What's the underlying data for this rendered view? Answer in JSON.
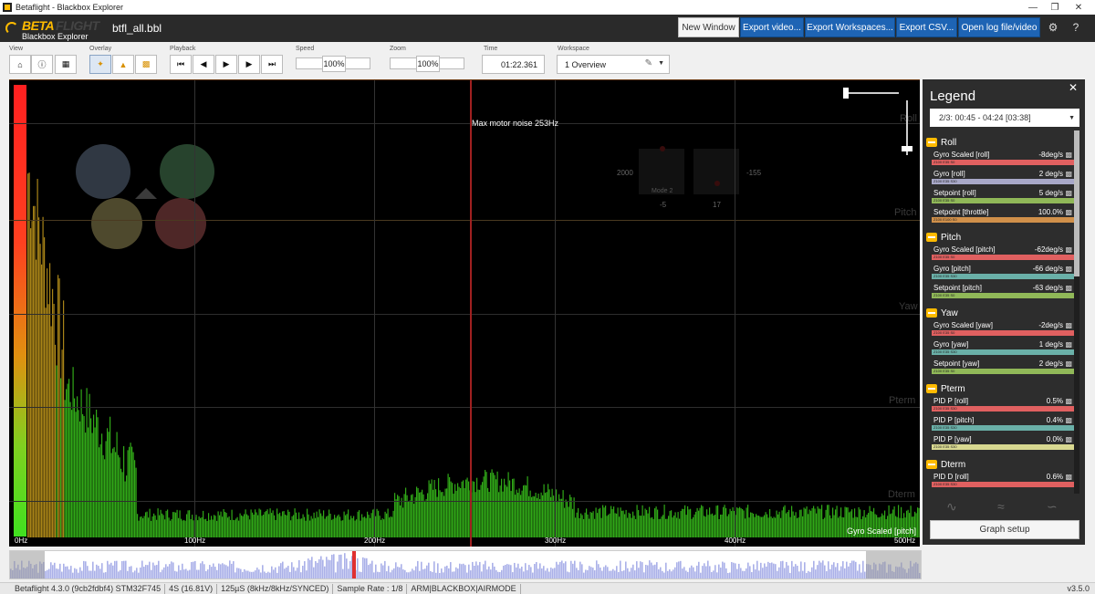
{
  "window": {
    "title": "Betaflight - Blackbox Explorer"
  },
  "app": {
    "logo_beta": "BETA",
    "logo_flight": "FLIGHT",
    "logo_sub": "Blackbox Explorer",
    "filename": "btfl_all.bbl"
  },
  "header_buttons": {
    "new_window": "New Window",
    "export_video": "Export video...",
    "export_workspaces": "Export Workspaces...",
    "export_csv": "Export CSV...",
    "open_log": "Open log file/video"
  },
  "toolbar": {
    "view_label": "View",
    "overlay_label": "Overlay",
    "playback_label": "Playback",
    "speed_label": "Speed",
    "zoom_label": "Zoom",
    "time_label": "Time",
    "workspace_label": "Workspace",
    "speed_value": "100%",
    "zoom_value": "100%",
    "time_value": "01:22.361",
    "workspace_value": "1 Overview"
  },
  "graph": {
    "max_noise_label": "Max motor noise 253Hz",
    "series_label": "Gyro Scaled [pitch]",
    "freq_ticks": [
      "0Hz",
      "100Hz",
      "200Hz",
      "300Hz",
      "400Hz",
      "500Hz"
    ],
    "faded_labels": [
      "Roll",
      "Pitch",
      "Yaw",
      "Pterm",
      "Dterm"
    ],
    "stick_left": "2000",
    "stick_right": "-155",
    "stick_mode": "Mode 2",
    "stick_left_bottom": "-5",
    "stick_right_bottom": "17"
  },
  "legend": {
    "title": "Legend",
    "range": "2/3: 00:45 - 04:24 [03:38]",
    "setup_button": "Graph setup",
    "groups": [
      {
        "name": "Roll",
        "items": [
          {
            "name": "Gyro Scaled [roll]",
            "value": "-8deg/s",
            "bar": "Z100 E35 S0",
            "color": "#e06060"
          },
          {
            "name": "Gyro [roll]",
            "value": "2 deg/s",
            "bar": "Z100 E35 S30",
            "color": "#a8a8c8"
          },
          {
            "name": "Setpoint [roll]",
            "value": "5 deg/s",
            "bar": "Z100 E35 S0",
            "color": "#90b858"
          },
          {
            "name": "Setpoint [throttle]",
            "value": "100.0%",
            "bar": "Z100 E100 S0",
            "color": "#d0904a"
          }
        ]
      },
      {
        "name": "Pitch",
        "items": [
          {
            "name": "Gyro Scaled [pitch]",
            "value": "-62deg/s",
            "bar": "Z100 E35 S0",
            "color": "#e06060"
          },
          {
            "name": "Gyro [pitch]",
            "value": "-66 deg/s",
            "bar": "Z100 E35 S30",
            "color": "#6ab0a8"
          },
          {
            "name": "Setpoint [pitch]",
            "value": "-63 deg/s",
            "bar": "Z100 E35 S0",
            "color": "#90b858"
          }
        ]
      },
      {
        "name": "Yaw",
        "items": [
          {
            "name": "Gyro Scaled [yaw]",
            "value": "-2deg/s",
            "bar": "Z100 E35 S0",
            "color": "#e06060"
          },
          {
            "name": "Gyro [yaw]",
            "value": "1 deg/s",
            "bar": "Z100 E35 S30",
            "color": "#6ab0a8"
          },
          {
            "name": "Setpoint [yaw]",
            "value": "2 deg/s",
            "bar": "Z100 E35 S0",
            "color": "#90b858"
          }
        ]
      },
      {
        "name": "Pterm",
        "items": [
          {
            "name": "PID P [roll]",
            "value": "0.5%",
            "bar": "Z100 E35 S30",
            "color": "#e06060"
          },
          {
            "name": "PID P [pitch]",
            "value": "0.4%",
            "bar": "Z100 E35 S30",
            "color": "#6ab0a8"
          },
          {
            "name": "PID P [yaw]",
            "value": "0.0%",
            "bar": "Z100 E35 S30",
            "color": "#d8d890"
          }
        ]
      },
      {
        "name": "Dterm",
        "items": [
          {
            "name": "PID D [roll]",
            "value": "0.6%",
            "bar": "Z100 E35 S30",
            "color": "#e06060"
          }
        ]
      }
    ]
  },
  "status": {
    "segments": [
      "Betaflight 4.3.0 (9cb2fdbf4) STM32F745",
      "4S (16.81V)",
      "125µS (8kHz/8kHz/SYNCED)",
      "Sample Rate : 1/8",
      "ARM|BLACKBOX|AIRMODE"
    ],
    "version": "v3.5.0"
  },
  "colors": {
    "accent": "#1e64b4",
    "brand": "#ffbb00",
    "spectrum": "#40e020",
    "marker": "#e03030"
  }
}
